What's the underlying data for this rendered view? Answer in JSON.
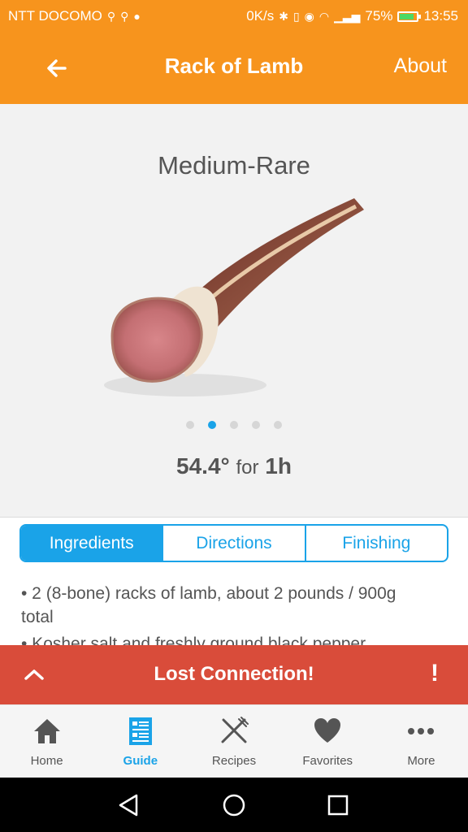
{
  "status_bar": {
    "carrier": "NTT DOCOMO",
    "speed": "0K/s",
    "battery": "75%",
    "battery_level": 0.75,
    "time": "13:55"
  },
  "app_bar": {
    "title": "Rack of Lamb",
    "about_label": "About",
    "color": "#f7941d"
  },
  "hero": {
    "doneness": "Medium-Rare",
    "page_count": 5,
    "active_page": 2,
    "temp_value": "54.4°",
    "temp_for": "for",
    "temp_time": "1h"
  },
  "tabs": [
    {
      "label": "Ingredients",
      "active": true
    },
    {
      "label": "Directions",
      "active": false
    },
    {
      "label": "Finishing",
      "active": false
    }
  ],
  "ingredients": [
    "• 2 (8-bone) racks of lamb, about 2 pounds / 900g total",
    "• Kosher salt and freshly ground black pepper"
  ],
  "banner": {
    "message": "Lost Connection!",
    "alert": "!",
    "color": "#d94c3a"
  },
  "bottom_nav": [
    {
      "label": "Home",
      "icon": "home-icon",
      "active": false
    },
    {
      "label": "Guide",
      "icon": "guide-icon",
      "active": true
    },
    {
      "label": "Recipes",
      "icon": "recipes-icon",
      "active": false
    },
    {
      "label": "Favorites",
      "icon": "favorites-icon",
      "active": false
    },
    {
      "label": "More",
      "icon": "more-icon",
      "active": false
    }
  ],
  "accent_color": "#1aa3e8"
}
